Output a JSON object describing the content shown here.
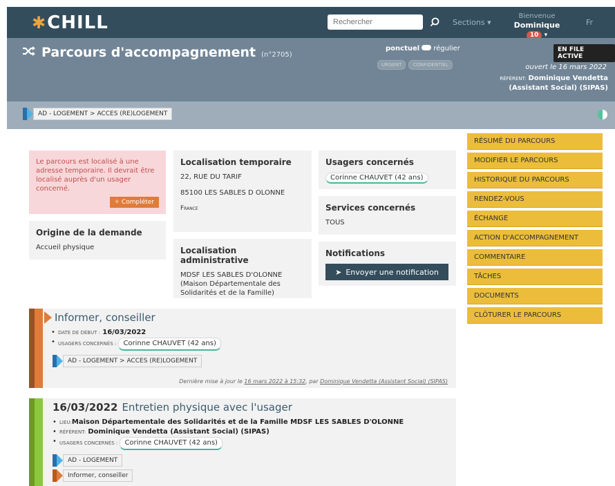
{
  "app": {
    "logo_text": "CHILL"
  },
  "search": {
    "placeholder": "Rechercher"
  },
  "nav": {
    "sections": "Sections ▾",
    "welcome": "Bienvenue",
    "user": "Dominique",
    "notif_count": "10",
    "lang": "Fr"
  },
  "banner": {
    "title": "Parcours d'accompagnement",
    "number": "(n°2705)",
    "ponctuel": "ponctuel",
    "regulier": "régulier",
    "tag_urgent": "URGENT",
    "tag_confidentiel": "CONFIDENTIEL",
    "status": "EN FILE ACTIVE",
    "opened": "ouvert le 16 mars 2022",
    "referent_label": "RÉFÉRENT:",
    "referent_name": "Dominique Vendetta (Assistant Social) (SIPAS)"
  },
  "social_issue": "AD - LOGEMENT > ACCES (RE)LOGEMENT",
  "cards": {
    "warning_text": "Le parcours est localisé à une adresse temporaire. Il devrait être localisé auprès d'un usager concerné.",
    "complete_button": "✧ Compléter",
    "origin_title": "Origine de la demande",
    "origin_value": "Accueil physique",
    "temp_loc_title": "Localisation temporaire",
    "temp_loc_street": "22, RUE DU TARIF",
    "temp_loc_city": "85100 LES SABLES D OLONNE",
    "temp_loc_country": "France",
    "admin_loc_title": "Localisation administrative",
    "admin_loc_value": "MDSF LES SABLES D'OLONNE (Maison Départementale des Solidarités et de la Famille)",
    "users_title": "Usagers concernés",
    "users_value": "Corinne CHAUVET (42 ans)",
    "services_title": "Services concernés",
    "services_value": "TOUS",
    "notif_title": "Notifications",
    "notif_button": "Envoyer une notification"
  },
  "menu": [
    "RÉSUMÉ DU PARCOURS",
    "MODIFIER LE PARCOURS",
    "HISTORIQUE DU PARCOURS",
    "RENDEZ-VOUS",
    "ÉCHANGE",
    "ACTION D'ACCOMPAGNEMENT",
    "COMMENTAIRE",
    "TÂCHES",
    "DOCUMENTS",
    "CLÔTURER LE PARCOURS"
  ],
  "activity1": {
    "title": "Informer, conseiller",
    "date_label": "DATE DE DÉBUT :",
    "date_value": "16/03/2022",
    "users_label": "USAGERS CONCERNÉS :",
    "users_value": "Corinne CHAUVET (42 ans)",
    "issue": "AD - LOGEMENT > ACCES (RE)LOGEMENT",
    "footer_prefix": "Dernière mise à jour le",
    "footer_date": "16 mars 2022 à 15:32",
    "footer_by": ", par",
    "footer_user": "Dominique Vendetta (Assistant Social) (SIPAS)"
  },
  "activity2": {
    "date": "16/03/2022",
    "title": "Entretien physique avec l'usager",
    "lieu_label": "LIEU:",
    "lieu_value": "Maison Départementale des Solidarités et de la Famille MDSF LES SABLES D'OLONNE",
    "ref_label": "RÉFÉRENT:",
    "ref_value": "Dominique Vendetta (Assistant Social) (SIPAS)",
    "users_label": "USAGERS CONCERNÉS :",
    "users_value": "Corinne CHAUVET (42 ans)",
    "issue": "AD - LOGEMENT",
    "action": "Informer, conseiller"
  }
}
